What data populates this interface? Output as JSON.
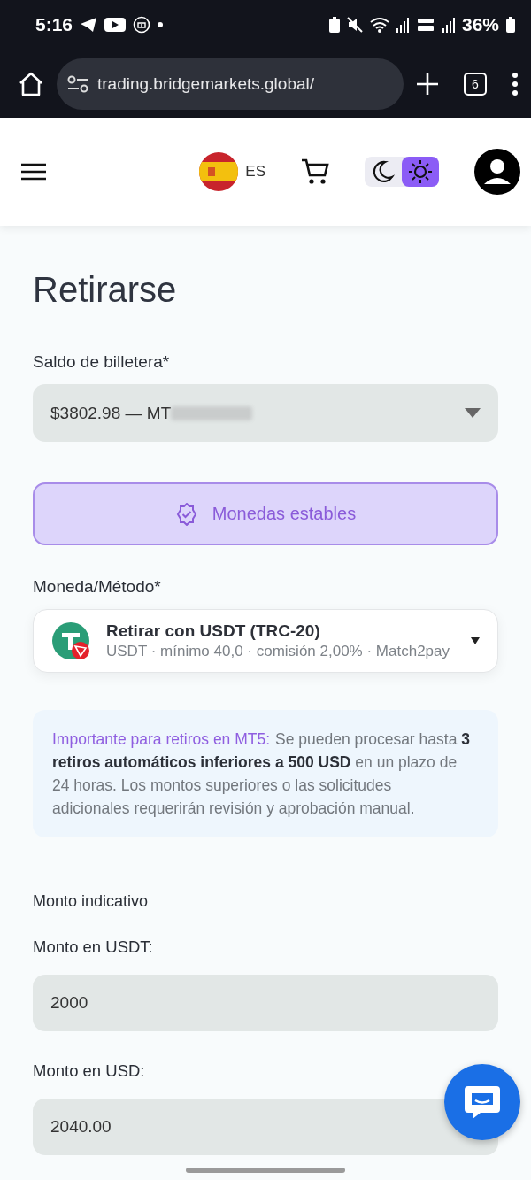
{
  "status_bar": {
    "time": "5:16",
    "battery": "36%"
  },
  "browser": {
    "url": "trading.bridgemarkets.global/",
    "tab_count": "6"
  },
  "header": {
    "language": "ES",
    "theme_options": [
      {
        "kind": "moon",
        "selected": false
      },
      {
        "kind": "sun",
        "selected": true
      }
    ]
  },
  "page": {
    "title": "Retirarse",
    "wallet": {
      "label": "Saldo de billetera*",
      "value": "$3802.98 — MT",
      "redacted": true
    },
    "category_button": {
      "label": "Monedas estables",
      "selected": true
    },
    "method": {
      "label": "Moneda/Método*",
      "title": "Retirar con USDT (TRC-20)",
      "details": "USDT · mínimo 40,0 · comisión 2,00% · Match2pay"
    },
    "note": {
      "heading": "Importante para retiros en MT5:",
      "text": "Se pueden procesar hasta **3 retiros automáticos inferiores a 500 USD** en un plazo de 24 horas. Los montos superiores o las solicitudes adicionales requerirán revisión y aprobación manual."
    },
    "indicative_label": "Monto indicativo",
    "amounts": [
      {
        "label": "Monto en USDT:",
        "value": "2000"
      },
      {
        "label": "Monto en USD:",
        "value": "2040.00"
      }
    ]
  }
}
